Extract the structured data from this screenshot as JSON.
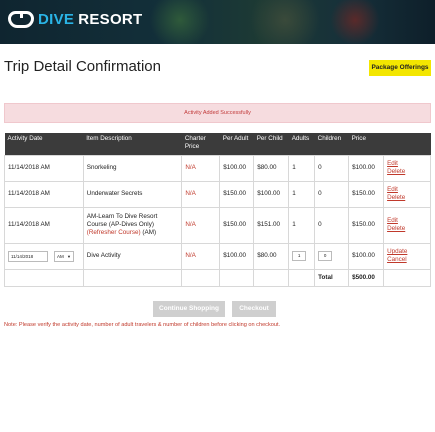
{
  "brand": {
    "name_part1": "DIVE",
    "name_part2": "RESORT"
  },
  "page": {
    "title": "Trip Detail Confirmation",
    "package_button": "Package Offerings"
  },
  "alert": {
    "message": "Activity Added Successfully"
  },
  "table": {
    "headers": [
      "Activity Date",
      "Item Description",
      "Charter Price",
      "Per Adult",
      "Per Child",
      "Adults",
      "Children",
      "Price",
      ""
    ],
    "rows": [
      {
        "date": "11/14/2018 AM",
        "desc": "Snorkeling",
        "desc_extra": "",
        "desc_suffix": "",
        "charter": "N/A",
        "per_adult": "$100.00",
        "per_child": "$80.00",
        "adults": "1",
        "children": "0",
        "price": "$100.00",
        "action1": "Edit",
        "action2": "Delete"
      },
      {
        "date": "11/14/2018 AM",
        "desc": "Underwater Secrets",
        "desc_extra": "",
        "desc_suffix": "",
        "charter": "N/A",
        "per_adult": "$150.00",
        "per_child": "$100.00",
        "adults": "1",
        "children": "0",
        "price": "$150.00",
        "action1": "Edit",
        "action2": "Delete"
      },
      {
        "date": "11/14/2018 AM",
        "desc": "AM-Learn To Dive Resort Course (AP-Dives Only)",
        "desc_extra": "(Refresher Course)",
        "desc_suffix": " (AM)",
        "charter": "N/A",
        "per_adult": "$150.00",
        "per_child": "$151.00",
        "adults": "1",
        "children": "0",
        "price": "$150.00",
        "action1": "Edit",
        "action2": "Delete"
      },
      {
        "date_input": "11/14/2018",
        "ampm": "AM",
        "desc": "Dive Activity",
        "charter": "N/A",
        "per_adult": "$100.00",
        "per_child": "$80.00",
        "adults_input": "1",
        "children_input": "0",
        "price": "$100.00",
        "action1": "Update",
        "action2": "Cancel"
      }
    ],
    "total_label": "Total",
    "total_value": "$500.00"
  },
  "buttons": {
    "continue": "Continue Shopping",
    "checkout": "Checkout"
  },
  "note": "Note: Please verify the activity date, number of adult travelers & number of children before clicking on checkout.",
  "colors": {
    "accent": "#2ab4e6",
    "yellow": "#f3e600",
    "link_red": "#c0392b",
    "header_dark": "#3b3b3b"
  }
}
